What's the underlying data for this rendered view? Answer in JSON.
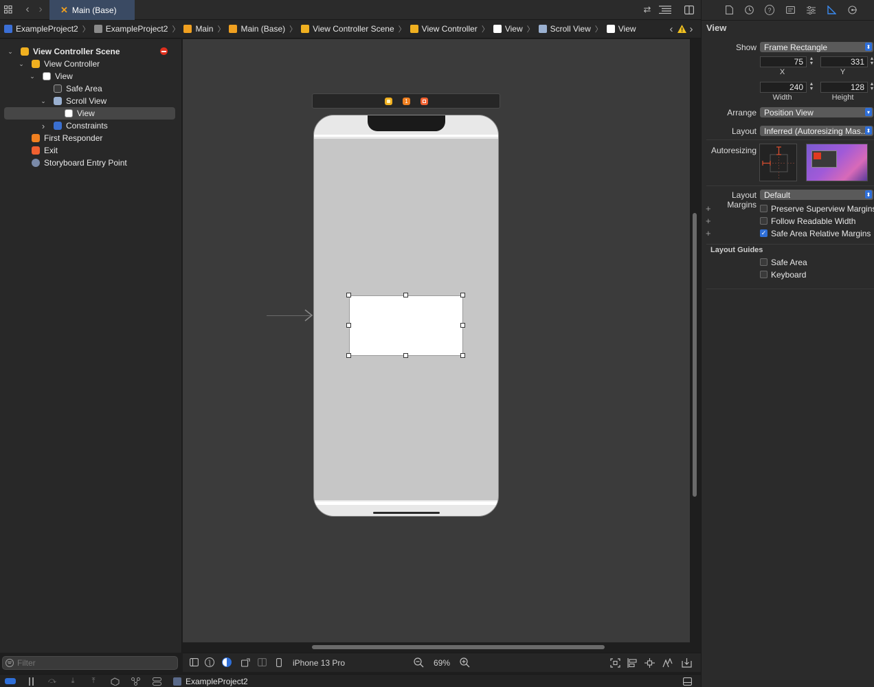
{
  "tab": {
    "title": "Main (Base)"
  },
  "breadcrumb": [
    {
      "label": "ExampleProject2",
      "icon": "project-icon",
      "color": "#3b6fd6"
    },
    {
      "label": "ExampleProject2",
      "icon": "folder-icon",
      "color": "#8a8a8a"
    },
    {
      "label": "Main",
      "icon": "storyboard-icon",
      "color": "#f0a020"
    },
    {
      "label": "Main (Base)",
      "icon": "storyboard-icon",
      "color": "#f0a020"
    },
    {
      "label": "View Controller Scene",
      "icon": "scene-icon",
      "color": "#f0b020"
    },
    {
      "label": "View Controller",
      "icon": "view-controller-icon",
      "color": "#f0b020"
    },
    {
      "label": "View",
      "icon": "view-icon",
      "color": "#ffffff"
    },
    {
      "label": "Scroll View",
      "icon": "scroll-view-icon",
      "color": "#9ab0d0"
    },
    {
      "label": "View",
      "icon": "view-icon",
      "color": "#ffffff"
    }
  ],
  "navigator": {
    "items": [
      {
        "label": "View Controller Scene",
        "indent": 0,
        "disclosure": "open",
        "icon": "scene-icon",
        "color": "#f0b020",
        "bold": true
      },
      {
        "label": "View Controller",
        "indent": 1,
        "disclosure": "open",
        "icon": "view-controller-icon",
        "color": "#f0b020"
      },
      {
        "label": "View",
        "indent": 2,
        "disclosure": "open",
        "icon": "view-icon",
        "color": "#ffffff"
      },
      {
        "label": "Safe Area",
        "indent": 3,
        "disclosure": "",
        "icon": "safe-area-icon",
        "color": "#3a3a3a"
      },
      {
        "label": "Scroll View",
        "indent": 3,
        "disclosure": "open",
        "icon": "scroll-view-icon",
        "color": "#9ab0d0"
      },
      {
        "label": "View",
        "indent": 4,
        "disclosure": "",
        "icon": "view-icon",
        "color": "#ffffff",
        "selected": true
      },
      {
        "label": "Constraints",
        "indent": 3,
        "disclosure": "closed",
        "icon": "constraints-icon",
        "color": "#3a6fd0"
      },
      {
        "label": "First Responder",
        "indent": 1,
        "disclosure": "",
        "icon": "first-responder-icon",
        "color": "#f08020"
      },
      {
        "label": "Exit",
        "indent": 1,
        "disclosure": "",
        "icon": "exit-icon",
        "color": "#f06030"
      },
      {
        "label": "Storyboard Entry Point",
        "indent": 1,
        "disclosure": "",
        "icon": "entry-point-icon",
        "color": "#7a8aa8"
      }
    ],
    "filter_placeholder": "Filter"
  },
  "inspector": {
    "section_title": "View",
    "show_label": "Show",
    "show_value": "Frame Rectangle",
    "x_value": "75",
    "y_value": "331",
    "x_caption": "X",
    "y_caption": "Y",
    "width_value": "240",
    "height_value": "128",
    "width_caption": "Width",
    "height_caption": "Height",
    "arrange_label": "Arrange",
    "arrange_value": "Position View",
    "layout_label": "Layout",
    "layout_value": "Inferred (Autoresizing Mas...",
    "autoresizing_label": "Autoresizing",
    "layout_margins_label": "Layout Margins",
    "layout_margins_value": "Default",
    "checks": [
      {
        "label": "Preserve Superview Margins",
        "checked": false
      },
      {
        "label": "Follow Readable Width",
        "checked": false
      },
      {
        "label": "Safe Area Relative Margins",
        "checked": true
      }
    ],
    "layout_guides_title": "Layout Guides",
    "guides": [
      {
        "label": "Safe Area",
        "checked": false
      },
      {
        "label": "Keyboard",
        "checked": false
      }
    ]
  },
  "canvas_bar": {
    "device": "iPhone 13 Pro",
    "zoom": "69%"
  },
  "debug_bar": {
    "scheme": "ExampleProject2"
  }
}
